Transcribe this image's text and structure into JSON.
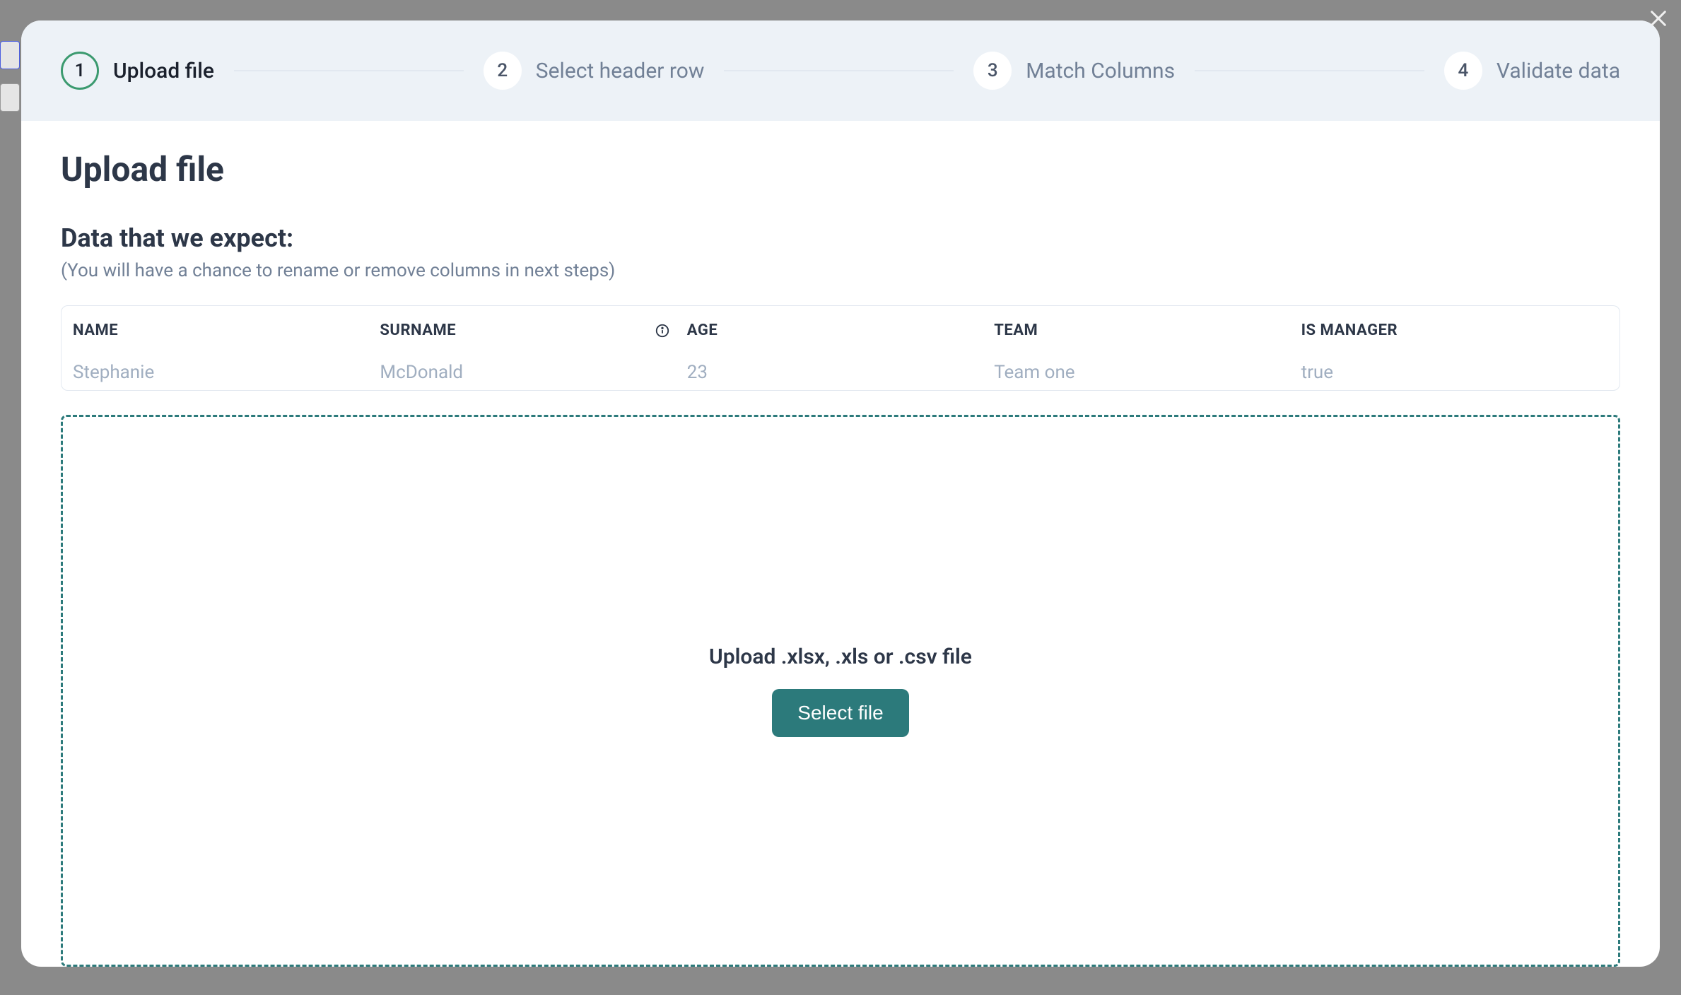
{
  "stepper": {
    "steps": [
      {
        "num": "1",
        "label": "Upload file"
      },
      {
        "num": "2",
        "label": "Select header row"
      },
      {
        "num": "3",
        "label": "Match Columns"
      },
      {
        "num": "4",
        "label": "Validate data"
      }
    ]
  },
  "page_title": "Upload file",
  "expected": {
    "title": "Data that we expect:",
    "subtitle": "(You will have a chance to rename or remove columns in next steps)",
    "columns": [
      {
        "header": "NAME"
      },
      {
        "header": "SURNAME"
      },
      {
        "header": "AGE"
      },
      {
        "header": "TEAM"
      },
      {
        "header": "IS MANAGER"
      }
    ],
    "row": {
      "name": "Stephanie",
      "surname": "McDonald",
      "age": "23",
      "team": "Team one",
      "is_manager": "true"
    }
  },
  "dropzone": {
    "title": "Upload .xlsx, .xls or .csv file",
    "button": "Select file"
  },
  "colors": {
    "accent": "#2c7a7b",
    "step_active_border": "#3b9a6f"
  }
}
